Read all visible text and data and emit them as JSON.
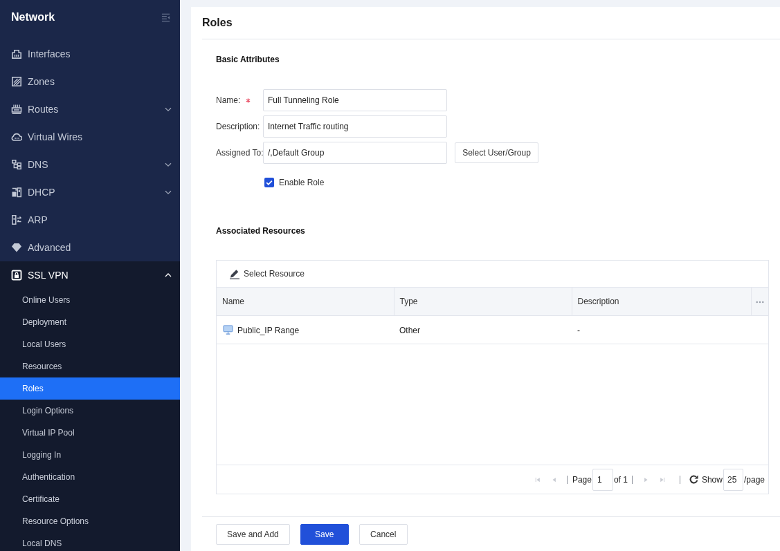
{
  "sidebar": {
    "title": "Network",
    "items": [
      {
        "label": "Interfaces",
        "kind": "link"
      },
      {
        "label": "Zones",
        "kind": "link"
      },
      {
        "label": "Routes",
        "kind": "group",
        "expanded": false
      },
      {
        "label": "Virtual Wires",
        "kind": "link"
      },
      {
        "label": "DNS",
        "kind": "group",
        "expanded": false
      },
      {
        "label": "DHCP",
        "kind": "group",
        "expanded": false
      },
      {
        "label": "ARP",
        "kind": "link"
      },
      {
        "label": "Advanced",
        "kind": "link"
      },
      {
        "label": "SSL VPN",
        "kind": "group",
        "expanded": true,
        "children": [
          {
            "label": "Online Users",
            "selected": false
          },
          {
            "label": "Deployment",
            "selected": false
          },
          {
            "label": "Local Users",
            "selected": false
          },
          {
            "label": "Resources",
            "selected": false
          },
          {
            "label": "Roles",
            "selected": true
          },
          {
            "label": "Login Options",
            "selected": false
          },
          {
            "label": "Virtual IP Pool",
            "selected": false
          },
          {
            "label": "Logging In",
            "selected": false
          },
          {
            "label": "Authentication",
            "selected": false
          },
          {
            "label": "Certificate",
            "selected": false
          },
          {
            "label": "Resource Options",
            "selected": false
          },
          {
            "label": "Local DNS",
            "selected": false
          }
        ]
      }
    ]
  },
  "page": {
    "title": "Roles"
  },
  "basic_attributes": {
    "heading": "Basic Attributes",
    "fields": [
      {
        "label": "Name:",
        "required": true,
        "value": "Full Tunneling Role"
      },
      {
        "label": "Description:",
        "required": false,
        "value": "Internet Traffic routing"
      },
      {
        "label": "Assigned To:",
        "required": false,
        "value": "/,Default Group",
        "button": "Select User/Group"
      }
    ],
    "enable_role": {
      "label": "Enable Role",
      "checked": true
    }
  },
  "associated_resources": {
    "heading": "Associated Resources",
    "toolbar_button": "Select Resource",
    "columns": [
      "Name",
      "Type",
      "Description"
    ],
    "rows": [
      {
        "cells": [
          "Public_IP Range",
          "Other",
          "-"
        ]
      }
    ],
    "pagination": {
      "nav": [
        {
          "kind": "first",
          "disabled": true
        },
        {
          "kind": "previous",
          "disabled": true
        },
        {
          "kind": "next",
          "disabled": true
        },
        {
          "kind": "last",
          "disabled": true
        }
      ],
      "page_label": "Page",
      "page": "1",
      "page_count": "of 1",
      "show_label": "Show",
      "per_page": "25",
      "per_page_suffix": "/page"
    }
  },
  "footer_buttons": [
    {
      "label": "Save and Add",
      "kind": "secondary"
    },
    {
      "label": "Save",
      "kind": "primary"
    },
    {
      "label": "Cancel",
      "kind": "secondary"
    }
  ]
}
